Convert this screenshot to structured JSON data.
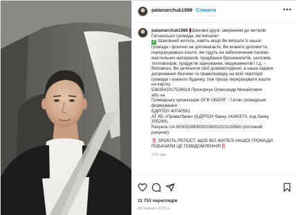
{
  "post": {
    "username": "palamarchuk1986",
    "separator": "•",
    "follow_label": "Стежити",
    "more_label": "•••"
  },
  "caption": {
    "username": "palamarchuk1986",
    "lines": [
      "Шановні друзі, звернення до жителів",
      "Гатненської громади, які виїхали!",
      "Шановний житель, навіть якщо Ви виїхали із нашої",
      "громади і фізично не допомагаєте, Ви можете допомогти,",
      "перерахувавши кошти, які підуть на забезпечення палево",
      "мастильних матеріалів, придбання бронежилетів, шоломів,",
      "тепловізорів, продуктів харчування, медикаментів і т.д. –",
      "Виїхавши, Ви залишили свої домоволодіння, а наша задача",
      "допримання безпеки та правопорядку на всій території",
      "громади і кожного будинку, тож прошу перерахувати кошти",
      "на картку :",
      "5363542017526618 Прохорчук Олександр Михайлович",
      "або на",
      "Громадську організацію ОГФ ОБЕРІГ - Гатне громадське",
      "формування",
      "ЄДРПОУ 40740591",
      "АТ КБ «Приватбанк» (ЄДРПОУ банку 14360570, код банку",
      "305299),",
      "Рахунок UA 603052990000026001010103580 (поточний",
      "рахунок)"
    ],
    "appeal_lines": [
      "‼️ ЗРОБІТЬ РЕПОСТ, ЩОБ ВСІ ЖИТЕЛІ НАШОЇ ГРОМАДИ",
      "ПОБАЧИЛИ ЦЕ ПОВІДОМЛЕННЯ!‼️"
    ],
    "time_ago": "22б тиж."
  },
  "actions": {
    "views": "11 753 переглядів",
    "date": "28 березня 2022 р."
  },
  "icons": [
    "like-heart-icon",
    "comment-icon",
    "share-icon",
    "save-bookmark-icon",
    "more-icon"
  ]
}
